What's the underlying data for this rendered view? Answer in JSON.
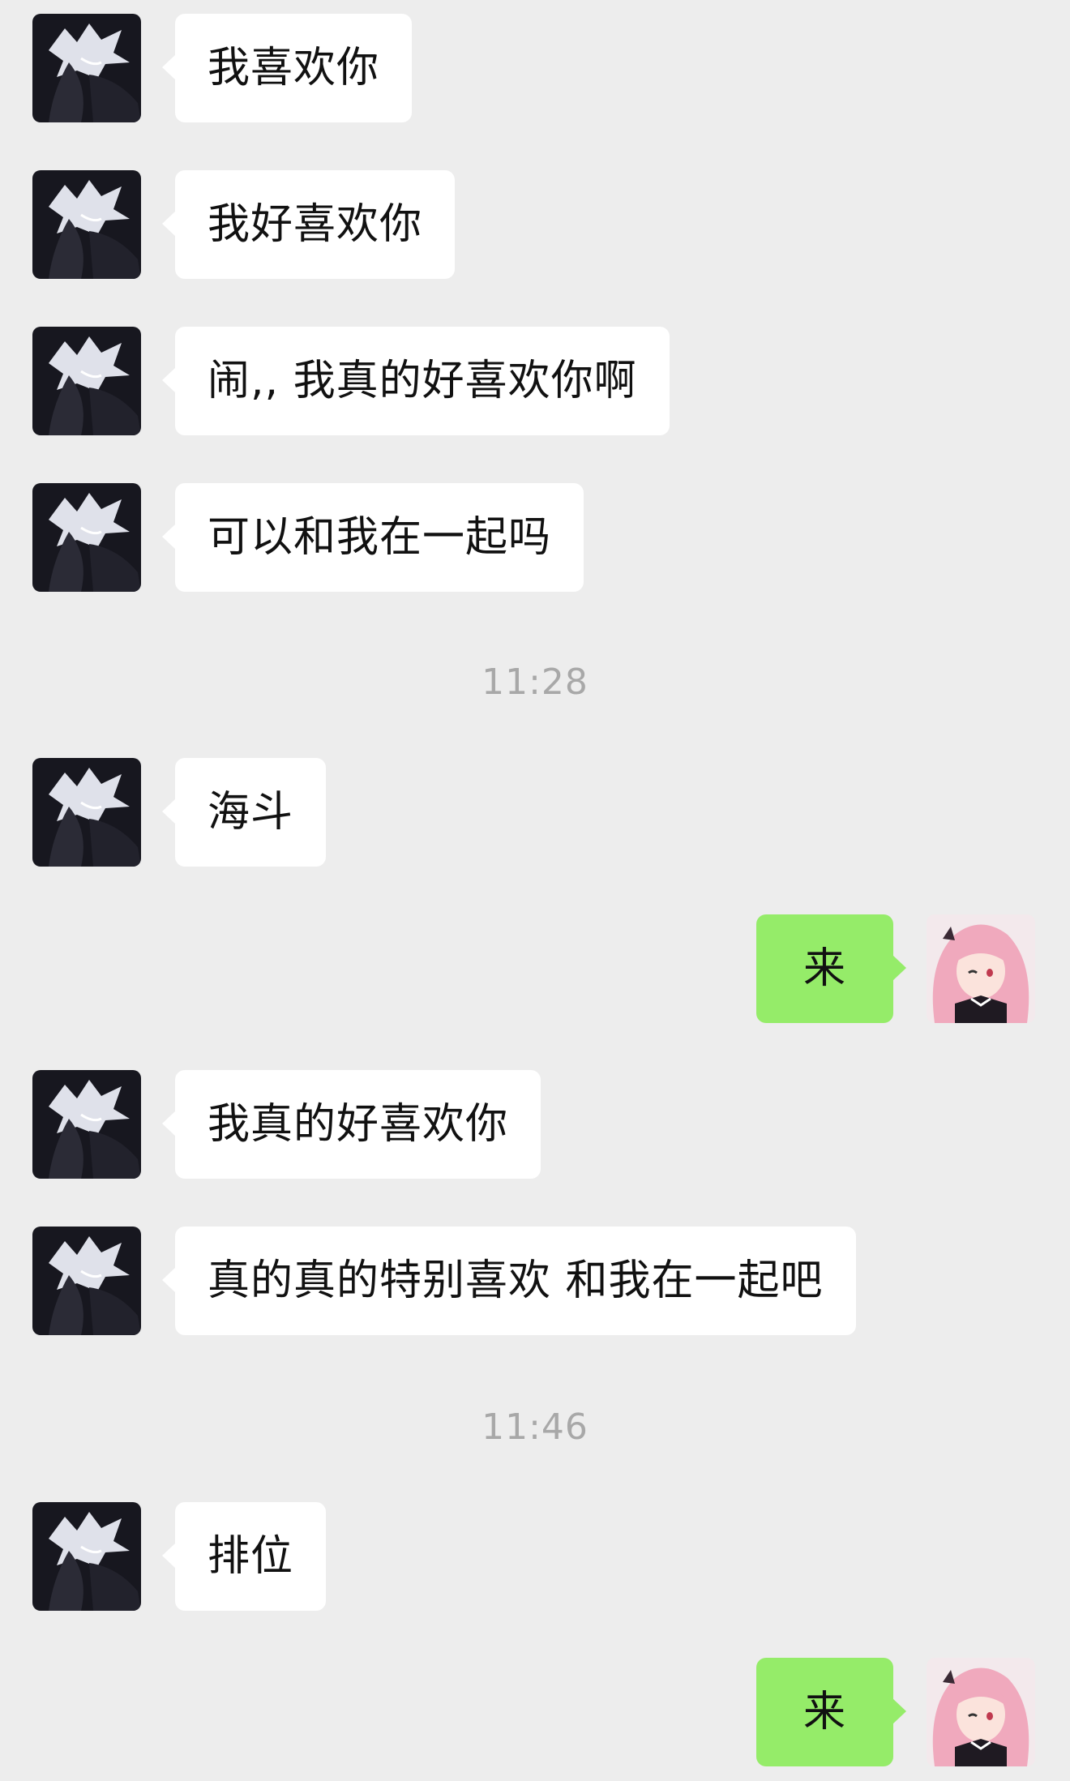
{
  "messages": [
    {
      "side": "left",
      "text": "我喜欢你"
    },
    {
      "side": "left",
      "text": "我好喜欢你"
    },
    {
      "side": "left",
      "text": " 闹,, 我真的好喜欢你啊"
    },
    {
      "side": "left",
      "text": "可以和我在一起吗"
    },
    {
      "time": "11:28"
    },
    {
      "side": "left",
      "text": "海斗"
    },
    {
      "side": "right",
      "text": "来"
    },
    {
      "side": "left",
      "text": "我真的好喜欢你"
    },
    {
      "side": "left",
      "text": "真的真的特别喜欢 和我在一起吧"
    },
    {
      "time": "11:46"
    },
    {
      "side": "left",
      "text": "排位"
    },
    {
      "side": "right",
      "text": "来"
    }
  ],
  "avatars": {
    "left": "dark-anime-boy-avatar",
    "right": "pink-hair-anime-girl-avatar"
  },
  "colors": {
    "background": "#ededed",
    "incoming_bubble": "#ffffff",
    "outgoing_bubble": "#95ec69",
    "timestamp": "#a8a8a8"
  }
}
